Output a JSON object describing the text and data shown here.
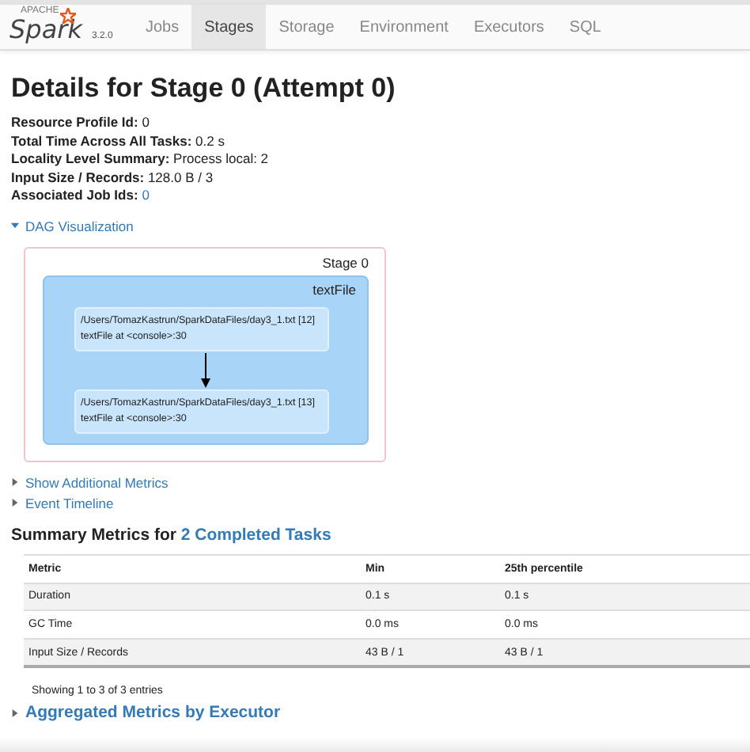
{
  "navbar": {
    "brand_small": "APACHE",
    "brand": "Spark",
    "version": "3.2.0",
    "tabs": [
      {
        "label": "Jobs",
        "selected": false
      },
      {
        "label": "Stages",
        "selected": true
      },
      {
        "label": "Storage",
        "selected": false
      },
      {
        "label": "Environment",
        "selected": false
      },
      {
        "label": "Executors",
        "selected": false
      },
      {
        "label": "SQL",
        "selected": false
      }
    ]
  },
  "title": "Details for Stage 0 (Attempt 0)",
  "summary": [
    {
      "label": "Resource Profile Id:",
      "value": "0",
      "kind": "text"
    },
    {
      "label": "Total Time Across All Tasks:",
      "value": "0.2 s",
      "kind": "text"
    },
    {
      "label": "Locality Level Summary:",
      "value": "Process local: 2",
      "kind": "text"
    },
    {
      "label": "Input Size / Records:",
      "value": "128.0 B / 3",
      "kind": "text"
    },
    {
      "label": "Associated Job Ids:",
      "value": "0",
      "kind": "link"
    }
  ],
  "dag": {
    "toggle": "DAG Visualization",
    "expanded": true,
    "stage_label": "Stage 0",
    "cluster_label": "textFile",
    "nodes": [
      {
        "path": "/Users/TomazKastrun/SparkDataFiles/day3_1.txt [12]",
        "call": "textFile at <console>:30"
      },
      {
        "path": "/Users/TomazKastrun/SparkDataFiles/day3_1.txt [13]",
        "call": "textFile at <console>:30"
      }
    ]
  },
  "toggles": [
    {
      "label": "Show Additional Metrics",
      "expanded": false
    },
    {
      "label": "Event Timeline",
      "expanded": false
    }
  ],
  "metrics": {
    "heading": "Summary Metrics for ",
    "heading_link": "2 Completed Tasks",
    "columns": [
      "Metric",
      "Min",
      "25th percentile"
    ],
    "rows": [
      [
        "Duration",
        "0.1 s",
        "0.1 s"
      ],
      [
        "GC Time",
        "0.0 ms",
        "0.0 ms"
      ],
      [
        "Input Size / Records",
        "43 B / 1",
        "43 B / 1"
      ]
    ],
    "footer": "Showing 1 to 3 of 3 entries"
  },
  "aggregated": {
    "label": "Aggregated Metrics by Executor",
    "expanded": false
  }
}
